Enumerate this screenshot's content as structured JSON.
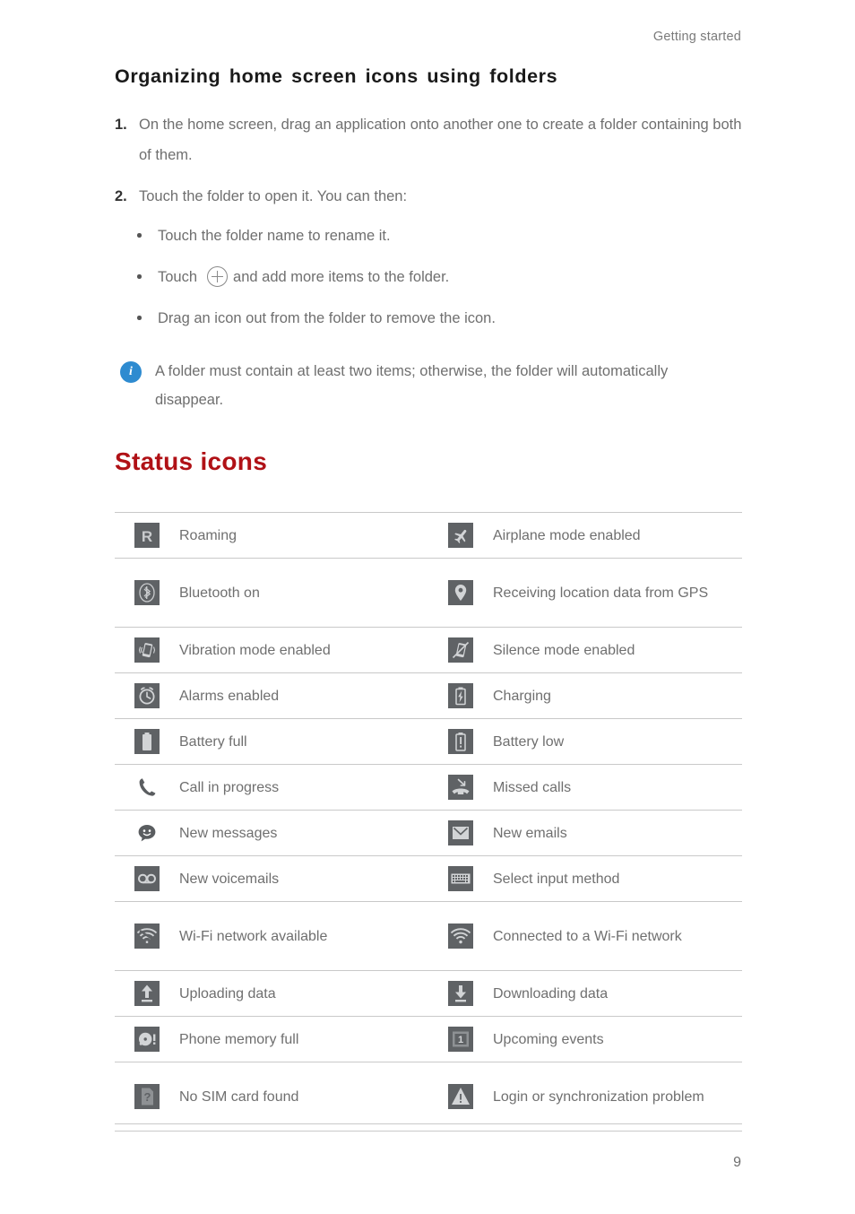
{
  "header": {
    "running_head": "Getting started"
  },
  "section": {
    "title": "Organizing home screen icons using folders",
    "steps": [
      {
        "num": "1.",
        "text": "On the home screen, drag an application onto another one to create a folder containing both of them."
      },
      {
        "num": "2.",
        "text": "Touch the folder to open it. You can then:"
      }
    ],
    "bullets": [
      {
        "text": "Touch the folder name to rename it.",
        "icon": null,
        "text_after": null
      },
      {
        "text": "Touch",
        "icon": "plus-circle-icon",
        "text_after": "and add more items to the folder."
      },
      {
        "text": "Drag an icon out from the folder to remove the icon.",
        "icon": null,
        "text_after": null
      }
    ],
    "note": {
      "icon": "info-icon",
      "icon_letter": "i",
      "text": "A folder must contain at least two items; otherwise, the folder will automatically disappear."
    }
  },
  "chapter": {
    "title": "Status icons"
  },
  "status_table": {
    "rows": [
      {
        "left_icon": "roaming-icon",
        "left_label": "Roaming",
        "right_icon": "airplane-mode-icon",
        "right_label": "Airplane mode enabled",
        "two_line": false
      },
      {
        "left_icon": "bluetooth-icon",
        "left_label": "Bluetooth on",
        "right_icon": "gps-location-icon",
        "right_label": "Receiving location data from GPS",
        "two_line": true
      },
      {
        "left_icon": "vibration-icon",
        "left_label": "Vibration mode enabled",
        "right_icon": "silence-mode-icon",
        "right_label": "Silence mode enabled",
        "two_line": false
      },
      {
        "left_icon": "alarm-clock-icon",
        "left_label": "Alarms enabled",
        "right_icon": "battery-charging-icon",
        "right_label": "Charging",
        "two_line": false
      },
      {
        "left_icon": "battery-full-icon",
        "left_label": "Battery full",
        "right_icon": "battery-low-icon",
        "right_label": "Battery low",
        "two_line": false
      },
      {
        "left_icon": "phone-handset-icon",
        "left_label": "Call in progress",
        "right_icon": "missed-call-icon",
        "right_label": "Missed calls",
        "two_line": false
      },
      {
        "left_icon": "new-message-icon",
        "left_label": "New messages",
        "right_icon": "new-email-icon",
        "right_label": "New emails",
        "two_line": false
      },
      {
        "left_icon": "voicemail-icon",
        "left_label": "New voicemails",
        "right_icon": "keyboard-icon",
        "right_label": "Select input method",
        "two_line": false
      },
      {
        "left_icon": "wifi-available-icon",
        "left_label": "Wi-Fi network available",
        "right_icon": "wifi-connected-icon",
        "right_label": "Connected to a Wi-Fi network",
        "two_line": true
      },
      {
        "left_icon": "upload-icon",
        "left_label": "Uploading data",
        "right_icon": "download-icon",
        "right_label": "Downloading data",
        "two_line": false
      },
      {
        "left_icon": "phone-memory-full-icon",
        "left_label": "Phone memory full",
        "right_icon": "calendar-event-icon",
        "right_label": "Upcoming events",
        "two_line": false
      },
      {
        "left_icon": "no-sim-card-icon",
        "left_label": "No SIM card found",
        "right_icon": "warning-icon",
        "right_label": "Login or synchronization problem",
        "two_line": true
      }
    ]
  },
  "footer": {
    "page_number": "9"
  },
  "colors": {
    "chapter_title": "#b01116",
    "body_text": "#6f6f6f",
    "icon_background": "#5f6265",
    "info_badge": "#2e8bd0",
    "rule": "#c9c9c9"
  }
}
